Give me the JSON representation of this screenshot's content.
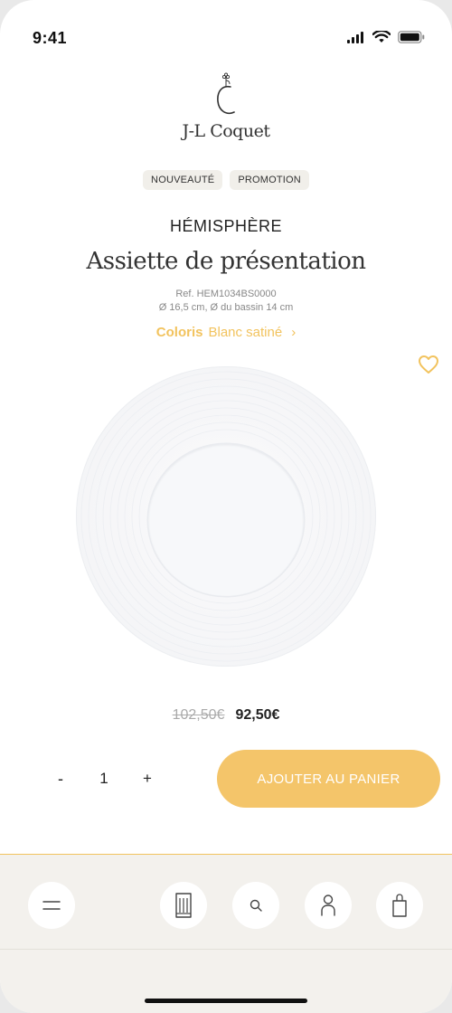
{
  "status_bar": {
    "time": "9:41"
  },
  "brand": {
    "name": "J-L Coquet",
    "logo_icon": "jl-monogram-icon"
  },
  "tags": [
    "NOUVEAUTÉ",
    "PROMOTION"
  ],
  "product": {
    "collection": "HÉMISPHÈRE",
    "title": "Assiette de présentation",
    "ref": "Ref. HEM1034BS0000",
    "dimensions": "Ø 16,5 cm, Ø du bassin 14 cm",
    "coloris_label": "Coloris",
    "coloris_value": "Blanc satiné"
  },
  "price": {
    "old": "102,50€",
    "new": "92,50€"
  },
  "cart": {
    "quantity": "1",
    "minus": "-",
    "plus": "+",
    "add_label": "AJOUTER AU PANIER"
  },
  "nav": {
    "items": [
      {
        "icon": "menu-icon"
      },
      {
        "icon": "tableware-icon"
      },
      {
        "icon": "search-icon"
      },
      {
        "icon": "user-icon"
      },
      {
        "icon": "shopping-bag-icon"
      }
    ]
  },
  "colors": {
    "accent": "#f2c35e",
    "button": "#f4c56a",
    "nav_bg": "#f3f1ed"
  }
}
